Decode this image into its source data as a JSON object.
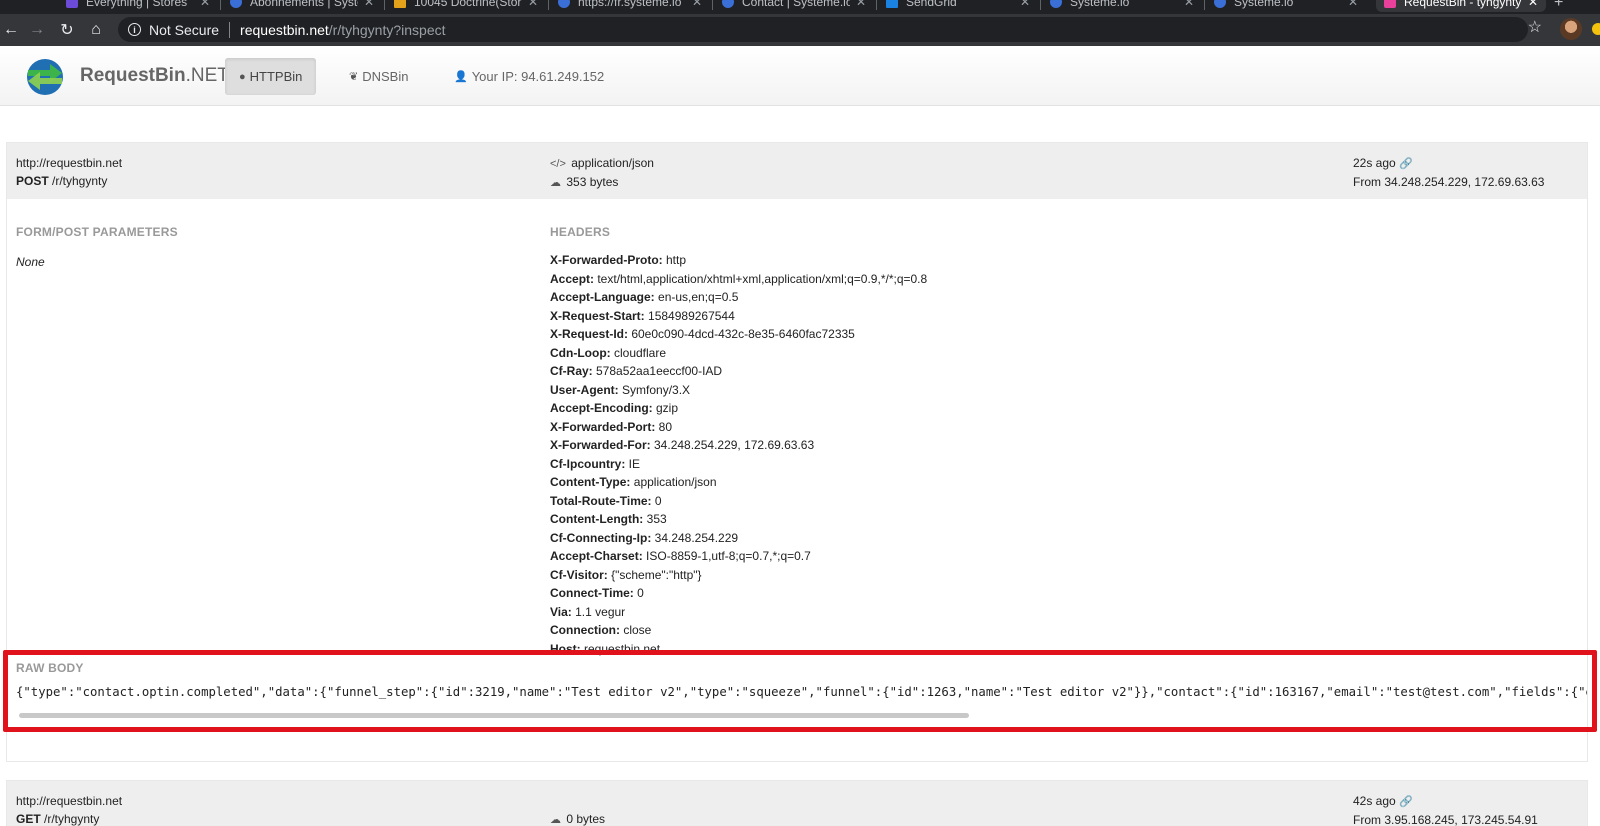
{
  "browser": {
    "tabs": [
      {
        "label": "Everything | Stores",
        "favicon_color": "#6b4bd8"
      },
      {
        "label": "Abonnements | Systeme.io",
        "favicon_color": "#3b6fd8"
      },
      {
        "label": "10045 Doctrine(Stor",
        "favicon_color": "#e3a21a"
      },
      {
        "label": "https://fr.systeme.io",
        "favicon_color": "#3b6fd8"
      },
      {
        "label": "Contact | Systeme.io",
        "favicon_color": "#3b6fd8"
      },
      {
        "label": "SendGrid",
        "favicon_color": "#1a82e2"
      },
      {
        "label": "Systeme.io",
        "favicon_color": "#3b6fd8"
      },
      {
        "label": "Systeme.io",
        "favicon_color": "#3b6fd8"
      },
      {
        "label": "RequestBin - tyhgynty",
        "favicon_color": "#e8409b"
      }
    ],
    "security_label": "Not Secure",
    "url_host": "requestbin.net",
    "url_path": "/r/tyhgynty?inspect"
  },
  "site": {
    "brand_main": "RequestBin",
    "brand_suffix": ".NET",
    "nav_httpbin": "HTTPBin",
    "nav_dnsbin": "DNSBin",
    "nav_ip": "Your IP: 94.61.249.152"
  },
  "request1": {
    "host": "http://requestbin.net",
    "method": "POST",
    "path": " /r/tyhgynty",
    "content_type": "application/json",
    "size": "353 bytes",
    "time_ago": "22s ago",
    "from": "From 34.248.254.229, 172.69.63.63",
    "form_title": "FORM/POST PARAMETERS",
    "form_value": "None",
    "headers_title": "HEADERS",
    "headers": [
      {
        "key": "X-Forwarded-Proto:",
        "value": " http"
      },
      {
        "key": "Accept:",
        "value": " text/html,application/xhtml+xml,application/xml;q=0.9,*/*;q=0.8"
      },
      {
        "key": "Accept-Language:",
        "value": " en-us,en;q=0.5"
      },
      {
        "key": "X-Request-Start:",
        "value": " 1584989267544"
      },
      {
        "key": "X-Request-Id:",
        "value": " 60e0c090-4dcd-432c-8e35-6460fac72335"
      },
      {
        "key": "Cdn-Loop:",
        "value": " cloudflare"
      },
      {
        "key": "Cf-Ray:",
        "value": " 578a52aa1eeccf00-IAD"
      },
      {
        "key": "User-Agent:",
        "value": " Symfony/3.X"
      },
      {
        "key": "Accept-Encoding:",
        "value": " gzip"
      },
      {
        "key": "X-Forwarded-Port:",
        "value": " 80"
      },
      {
        "key": "X-Forwarded-For:",
        "value": " 34.248.254.229, 172.69.63.63"
      },
      {
        "key": "Cf-Ipcountry:",
        "value": " IE"
      },
      {
        "key": "Content-Type:",
        "value": " application/json"
      },
      {
        "key": "Total-Route-Time:",
        "value": " 0"
      },
      {
        "key": "Content-Length:",
        "value": " 353"
      },
      {
        "key": "Cf-Connecting-Ip:",
        "value": " 34.248.254.229"
      },
      {
        "key": "Accept-Charset:",
        "value": " ISO-8859-1,utf-8;q=0.7,*;q=0.7"
      },
      {
        "key": "Cf-Visitor:",
        "value": " {\"scheme\":\"http\"}"
      },
      {
        "key": "Connect-Time:",
        "value": " 0"
      },
      {
        "key": "Via:",
        "value": " 1.1 vegur"
      },
      {
        "key": "Connection:",
        "value": " close"
      },
      {
        "key": "Host:",
        "value": " requestbin.net"
      }
    ],
    "raw_title": "RAW BODY",
    "raw_body": "{\"type\":\"contact.optin.completed\",\"data\":{\"funnel_step\":{\"id\":3219,\"name\":\"Test editor v2\",\"type\":\"squeeze\",\"funnel\":{\"id\":1263,\"name\":\"Test editor v2\"}},\"contact\":{\"id\":163167,\"email\":\"test@test.com\",\"fields\":{\"email\":\"test@test.com\"}}}}"
  },
  "request2": {
    "host": "http://requestbin.net",
    "method": "GET",
    "path": " /r/tyhgynty",
    "size": "0 bytes",
    "time_ago": "42s ago",
    "from": "From 3.95.168.245, 173.245.54.91"
  },
  "colors": {
    "highlight": "#e0121b",
    "link": "#3a7bd5",
    "logo_green": "#3cb44b",
    "logo_blue": "#1f6fb2"
  }
}
